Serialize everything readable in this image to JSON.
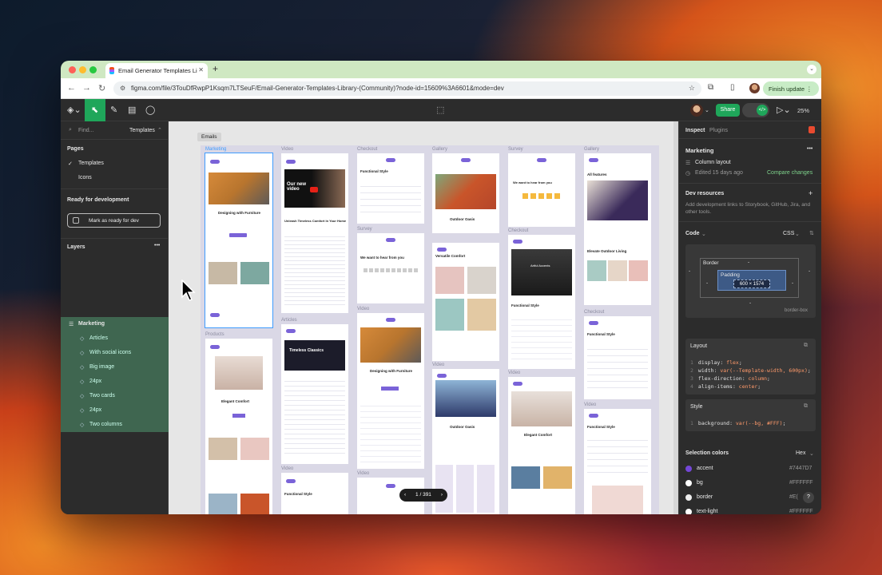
{
  "browser": {
    "tab_title": "Email Generator Templates Li",
    "url": "figma.com/file/3TouDfRwpP1Ksqm7LTSeuF/Email-Generator-Templates-Library-(Community)?node-id=15609%3A6601&mode=dev",
    "finish_update": "Finish update"
  },
  "toolbar": {
    "share": "Share",
    "zoom": "25%"
  },
  "left_panel": {
    "search_placeholder": "Find...",
    "templates_label": "Templates",
    "pages_heading": "Pages",
    "pages": [
      "Templates",
      "Icons"
    ],
    "ready_heading": "Ready for development",
    "ready_button": "Mark as ready for dev",
    "layers_heading": "Layers",
    "layers": [
      "Marketing",
      "Articles",
      "With social icons",
      "Big image",
      "24px",
      "Two cards",
      "24px",
      "Two columns"
    ]
  },
  "canvas": {
    "section_label": "Emails",
    "column_labels": [
      "Marketing",
      "Video",
      "Checkout",
      "Gallery",
      "Survey",
      "Gallery"
    ],
    "sub_labels": [
      "Products",
      "Articles",
      "Survey",
      "Video",
      "Video",
      "Video",
      "Checkout",
      "Checkout",
      "Video",
      "Video",
      "Video"
    ],
    "card_titles": [
      "Designing with Furniture",
      "Elegant Comfort",
      "Functional Style",
      "Outdoor Oasis",
      "Versatile Comfort",
      "We want to hear from you",
      "Artful Accents",
      "Timeless Classics",
      "Unleash Timeless Comfort In Your Home",
      "Our new video",
      "All features",
      "Elevate Outdoor Living"
    ],
    "pager": "1 / 391"
  },
  "right_panel": {
    "tabs": [
      "Inspect",
      "Plugins"
    ],
    "title": "Marketing",
    "layout_type": "Column layout",
    "edited": "Edited 15 days ago",
    "compare": "Compare changes",
    "dev_heading": "Dev resources",
    "dev_text": "Add development links to Storybook, GitHub, Jira, and other tools.",
    "code_heading": "Code",
    "code_lang": "CSS",
    "box_border": "Border",
    "box_padding": "Padding",
    "box_size": "600 × 1574",
    "box_dash": "-",
    "box_sizing": "border-box",
    "layout_heading": "Layout",
    "layout_code": [
      [
        "display",
        "flex"
      ],
      [
        "width",
        "var(--Template-width, 600px)"
      ],
      [
        "flex-direction",
        "column"
      ],
      [
        "align-items",
        "center"
      ]
    ],
    "style_heading": "Style",
    "style_code": [
      "background",
      "var(--bg, #FFF)"
    ],
    "colors_heading": "Selection colors",
    "colors_format": "Hex",
    "colors": [
      {
        "name": "accent",
        "hex": "#7447D7"
      },
      {
        "name": "bg",
        "hex": "#FFFFFF"
      },
      {
        "name": "border",
        "hex": "#E("
      },
      {
        "name": "text-light",
        "hex": "#FFFFFF"
      }
    ]
  },
  "colors": {
    "figma_green": "#1fa65a",
    "accent": "#7a63d8",
    "selection": "#3e9cff"
  }
}
